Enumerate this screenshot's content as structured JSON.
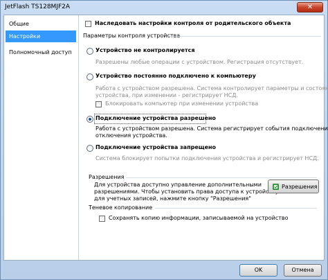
{
  "window": {
    "title": "JetFlash TS128MJF2A",
    "close_symbol": "✕"
  },
  "sidebar": {
    "items": [
      {
        "label": "Общие"
      },
      {
        "label": "Настройки"
      },
      {
        "label": "Полномочный доступ"
      }
    ]
  },
  "settings": {
    "inherit_checkbox": "Наследовать настройки контроля от родительского объекта",
    "group_title": "Параметры контроля устройства",
    "options": [
      {
        "label": "Устройство не контролируется",
        "desc": "Разрешены любые операции с устройством. Регистрация отсутствует."
      },
      {
        "label": "Устройство постоянно подключено к компьютеру",
        "desc1": "Работа с устройством разрешена. Система контролирует параметры и состояние",
        "desc2": "устройства, при изменении - регистрирует НСД.",
        "block_checkbox": "Блокировать компьютер при изменении устройства"
      },
      {
        "label": "Подключение устройства разрешено",
        "desc1": "Работа с устройством разрешена. Система регистрирует события подключения и",
        "desc2": "отключения устройства."
      },
      {
        "label": "Подключение устройства запрещено",
        "desc": "Система блокирует попытки подключения устройства и регистрирует НСД."
      }
    ],
    "permissions": {
      "title": "Разрешения",
      "text1": "Для устройства доступно управление дополнительными",
      "text2": "разрешениями.  Чтобы установить права доступа к устройству",
      "text3": "для учетных записей, нажмите кнопку \"Разрешения\"",
      "button": "Разрешения"
    },
    "shadow": {
      "title": "Теневое копирование",
      "checkbox": "Сохранять копию информации, записываемой на устройство"
    }
  },
  "footer": {
    "ok": "OK",
    "cancel": "Отмена"
  }
}
